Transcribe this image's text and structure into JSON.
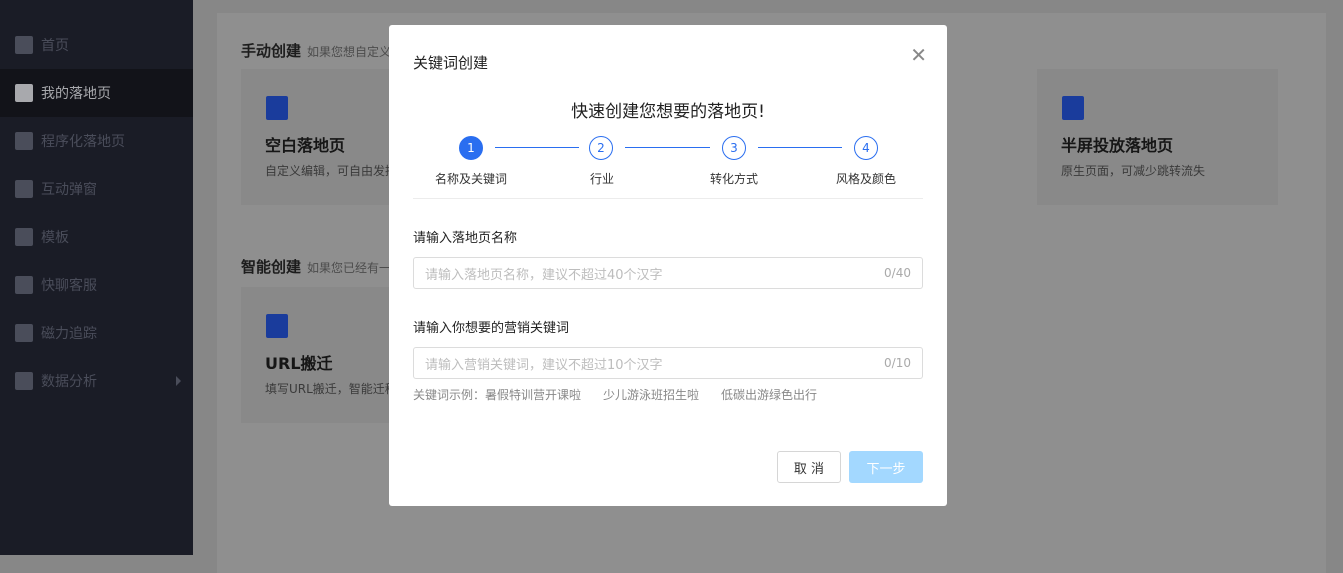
{
  "sidebar": {
    "items": [
      {
        "label": "首页",
        "icon": "home-icon"
      },
      {
        "label": "我的落地页",
        "icon": "document-icon",
        "active": true
      },
      {
        "label": "程序化落地页",
        "icon": "flow-icon"
      },
      {
        "label": "互动弹窗",
        "icon": "bookmark-icon"
      },
      {
        "label": "模板",
        "icon": "template-icon"
      },
      {
        "label": "快聊客服",
        "icon": "chat-icon"
      },
      {
        "label": "磁力追踪",
        "icon": "bookmark-icon"
      },
      {
        "label": "数据分析",
        "icon": "bar-chart-icon"
      }
    ]
  },
  "main": {
    "manual": {
      "title": "手动创建",
      "desc": "如果您想自定义"
    },
    "smart": {
      "title": "智能创建",
      "desc": "如果您已经有一"
    },
    "cards": [
      {
        "title": "空白落地页",
        "desc": "自定义编辑，可自由发挥"
      },
      {
        "title": "半屏投放落地页",
        "desc": "原生页面，可减少跳转流失"
      },
      {
        "title": "URL搬迁",
        "desc": "填写URL搬迁，智能迁移"
      }
    ]
  },
  "modal": {
    "title": "关键词创建",
    "close": "✕",
    "heading": "快速创建您想要的落地页!",
    "steps": [
      {
        "n": "1",
        "label": "名称及关键词"
      },
      {
        "n": "2",
        "label": "行业"
      },
      {
        "n": "3",
        "label": "转化方式"
      },
      {
        "n": "4",
        "label": "风格及颜色"
      }
    ],
    "name_label": "请输入落地页名称",
    "name_placeholder": "请输入落地页名称，建议不超过40个汉字",
    "name_count": "0/40",
    "kw_label": "请输入你想要的营销关键词",
    "kw_placeholder": "请输入营销关键词，建议不超过10个汉字",
    "kw_count": "0/10",
    "examples": [
      "关键词示例：暑假特训营开课啦",
      "少儿游泳班招生啦",
      "低碳出游绿色出行"
    ],
    "cancel": "取 消",
    "next": "下一步"
  }
}
